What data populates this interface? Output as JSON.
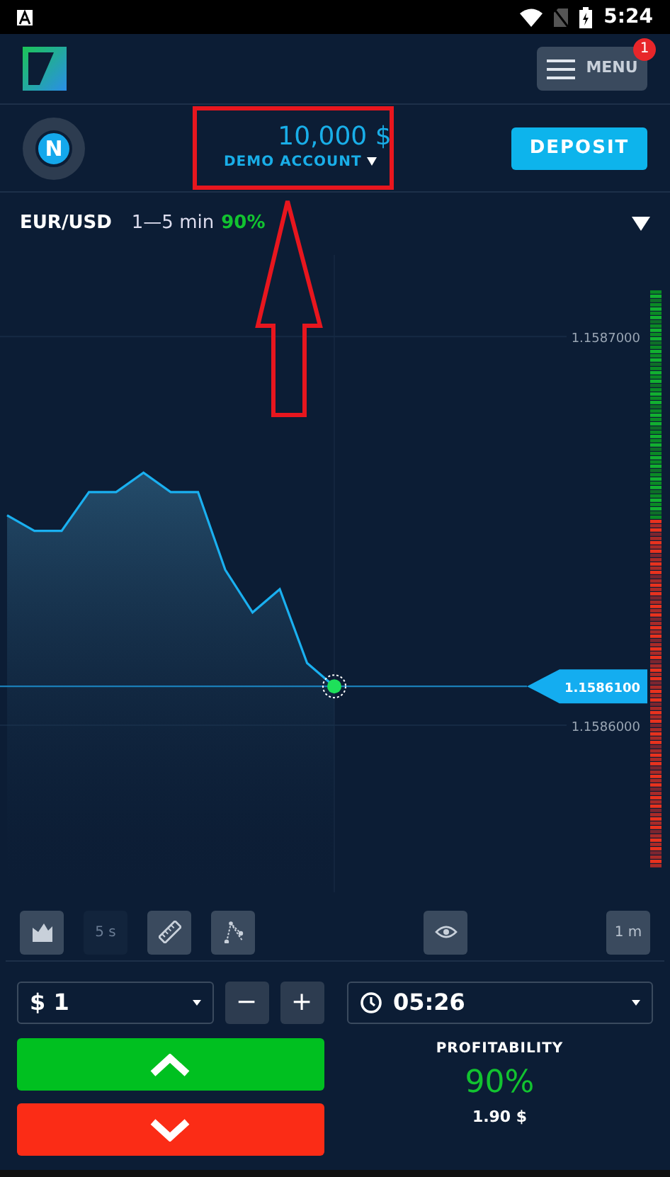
{
  "status_bar": {
    "time": "5:24"
  },
  "header": {
    "menu_label": "MENU",
    "menu_badge": "1"
  },
  "account": {
    "avatar_letter": "N",
    "balance": "10,000 $",
    "account_type": "DEMO ACCOUNT",
    "deposit_label": "DEPOSIT"
  },
  "asset": {
    "pair": "EUR/USD",
    "duration": "1—5 min",
    "payout": "90%"
  },
  "chart": {
    "current_price": "1.1586100",
    "chart_data": {
      "type": "area",
      "categories": [
        null,
        null,
        null,
        null,
        null,
        null,
        null,
        null,
        null,
        null,
        null,
        null,
        null
      ],
      "series": [
        {
          "color": "#1ab0f0",
          "values": [
            1.158654,
            1.15865,
            1.15865,
            1.15866,
            1.15866,
            1.158665,
            1.15866,
            1.15866,
            1.15864,
            1.158629,
            1.158635,
            1.158616,
            1.15861
          ]
        }
      ],
      "ylim": [
        1.158557,
        1.158721
      ],
      "ref_lines": [
        {
          "axis": "y",
          "value": 1.15861
        }
      ],
      "yticks": [
        {
          "value": 1.1587,
          "label": "1.1587000"
        },
        {
          "value": 1.1586,
          "label": "1.1586000"
        }
      ]
    }
  },
  "tools": [
    {
      "kind": "area-chart",
      "disabled": false
    },
    {
      "kind": "text",
      "label": "5 s",
      "disabled": true
    },
    {
      "kind": "ruler",
      "disabled": false
    },
    {
      "kind": "drawing",
      "disabled": false
    },
    {
      "kind": "eye",
      "disabled": false
    },
    {
      "kind": "text",
      "label": "1 m",
      "disabled": false
    }
  ],
  "trade": {
    "amount": "$ 1",
    "minus": "−",
    "plus": "+",
    "expiry": "05:26",
    "profitability_label": "PROFITABILITY",
    "profitability": "90%",
    "payout_amount": "1.90 $"
  }
}
